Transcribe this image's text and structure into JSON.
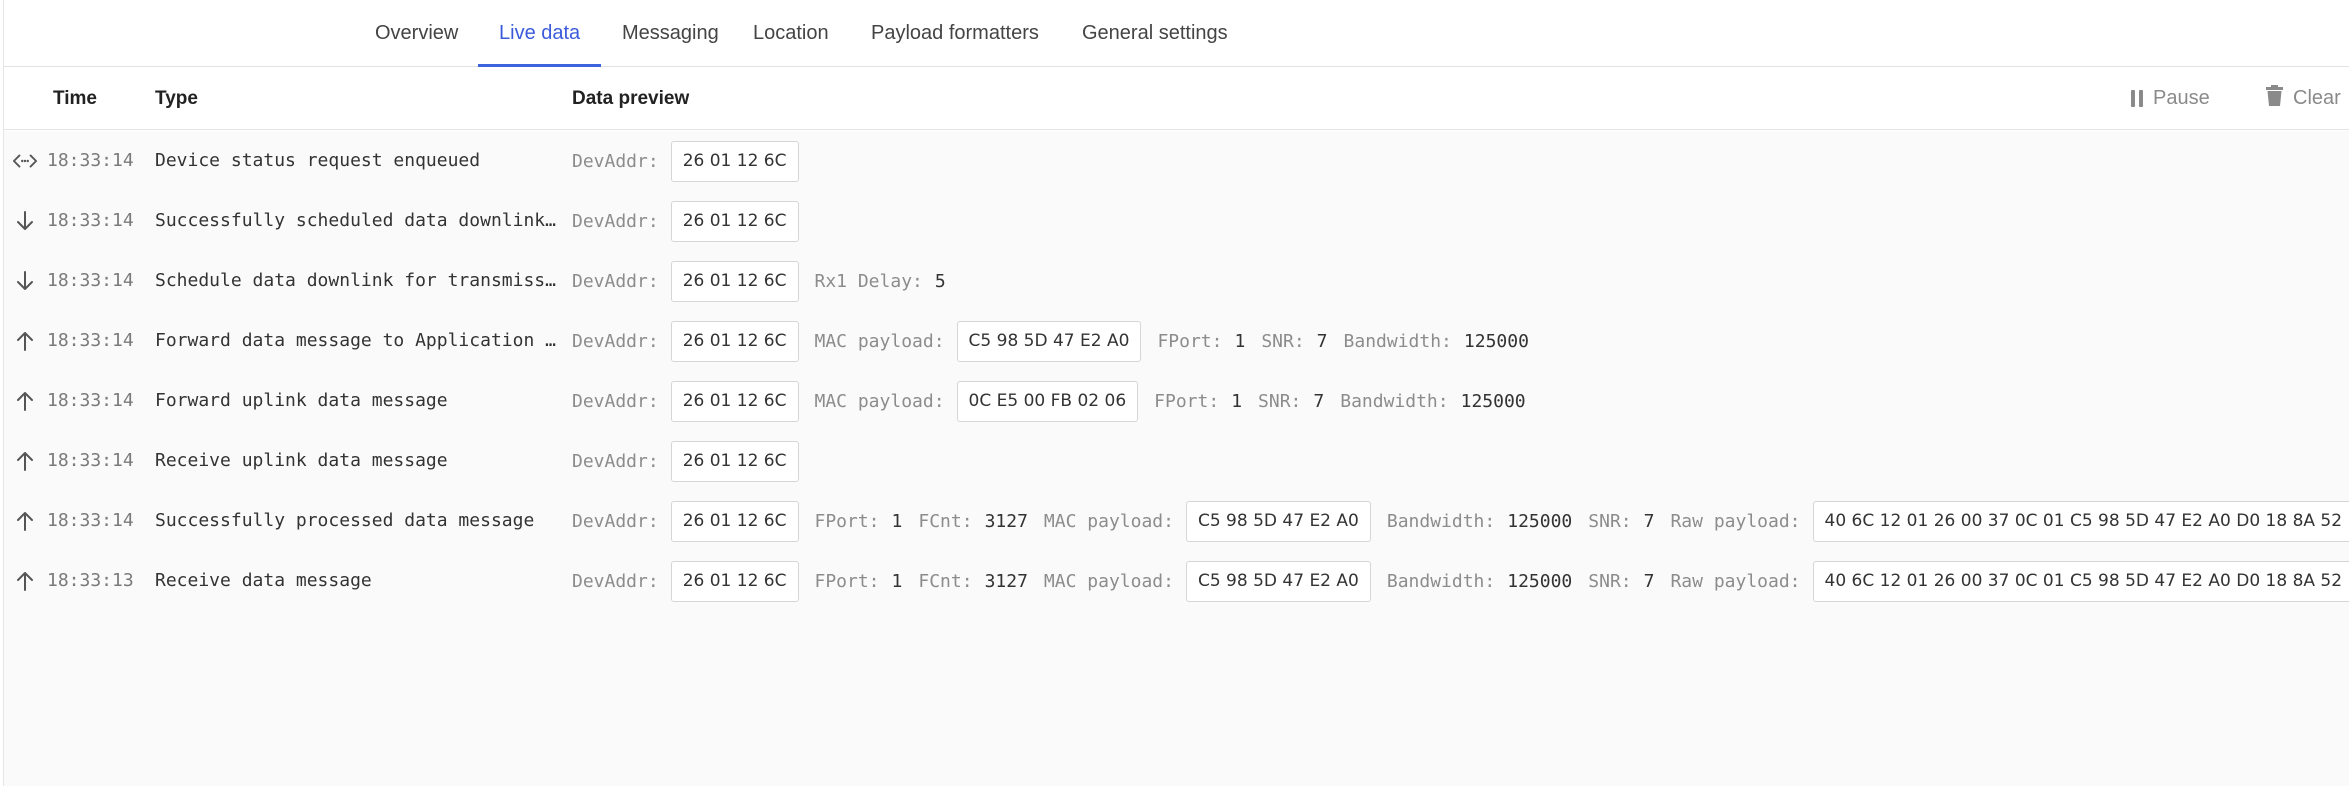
{
  "tabs": [
    {
      "label": "Overview",
      "active": false
    },
    {
      "label": "Live data",
      "active": true
    },
    {
      "label": "Messaging",
      "active": false
    },
    {
      "label": "Location",
      "active": false
    },
    {
      "label": "Payload formatters",
      "active": false
    },
    {
      "label": "General settings",
      "active": false
    }
  ],
  "header": {
    "time": "Time",
    "type": "Type",
    "preview": "Data preview",
    "pause": "Pause",
    "clear": "Clear"
  },
  "colors": {
    "accent": "#3d63dd",
    "label": "#8c8c8c"
  },
  "rows": [
    {
      "icon": "bidirectional-arrow-icon",
      "time": "18:33:14",
      "type": "Device status request enqueued",
      "fields": [
        {
          "label": "DevAddr:",
          "value": "26 01 12 6C",
          "boxed": true
        }
      ]
    },
    {
      "icon": "arrow-down-icon",
      "time": "18:33:14",
      "type": "Successfully scheduled data downlink for transmission",
      "fields": [
        {
          "label": "DevAddr:",
          "value": "26 01 12 6C",
          "boxed": true
        }
      ]
    },
    {
      "icon": "arrow-down-icon",
      "time": "18:33:14",
      "type": "Schedule data downlink for transmission",
      "fields": [
        {
          "label": "DevAddr:",
          "value": "26 01 12 6C",
          "boxed": true
        },
        {
          "label": "Rx1 Delay:",
          "value": "5",
          "boxed": false
        }
      ]
    },
    {
      "icon": "arrow-up-icon",
      "time": "18:33:14",
      "type": "Forward data message to Application Server",
      "fields": [
        {
          "label": "DevAddr:",
          "value": "26 01 12 6C",
          "boxed": true
        },
        {
          "label": "MAC payload:",
          "value": "C5 98 5D 47 E2 A0",
          "boxed": true
        },
        {
          "label": "FPort:",
          "value": "1",
          "boxed": false
        },
        {
          "label": "SNR:",
          "value": "7",
          "boxed": false
        },
        {
          "label": "Bandwidth:",
          "value": "125000",
          "boxed": false
        }
      ]
    },
    {
      "icon": "arrow-up-icon",
      "time": "18:33:14",
      "type": "Forward uplink data message",
      "fields": [
        {
          "label": "DevAddr:",
          "value": "26 01 12 6C",
          "boxed": true
        },
        {
          "label": "MAC payload:",
          "value": "0C E5 00 FB 02 06",
          "boxed": true
        },
        {
          "label": "FPort:",
          "value": "1",
          "boxed": false
        },
        {
          "label": "SNR:",
          "value": "7",
          "boxed": false
        },
        {
          "label": "Bandwidth:",
          "value": "125000",
          "boxed": false
        }
      ]
    },
    {
      "icon": "arrow-up-icon",
      "time": "18:33:14",
      "type": "Receive uplink data message",
      "fields": [
        {
          "label": "DevAddr:",
          "value": "26 01 12 6C",
          "boxed": true
        }
      ]
    },
    {
      "icon": "arrow-up-icon",
      "time": "18:33:14",
      "type": "Successfully processed data message",
      "fields": [
        {
          "label": "DevAddr:",
          "value": "26 01 12 6C",
          "boxed": true
        },
        {
          "label": "FPort:",
          "value": "1",
          "boxed": false
        },
        {
          "label": "FCnt:",
          "value": "3127",
          "boxed": false
        },
        {
          "label": "MAC payload:",
          "value": "C5 98 5D 47 E2 A0",
          "boxed": true
        },
        {
          "label": "Bandwidth:",
          "value": "125000",
          "boxed": false
        },
        {
          "label": "SNR:",
          "value": "7",
          "boxed": false
        },
        {
          "label": "Raw payload:",
          "value": "40 6C 12 01 26 00 37 0C 01 C5 98 5D 47 E2 A0 D0 18 8A 52",
          "boxed": true
        }
      ]
    },
    {
      "icon": "arrow-up-icon",
      "time": "18:33:13",
      "type": "Receive data message",
      "fields": [
        {
          "label": "DevAddr:",
          "value": "26 01 12 6C",
          "boxed": true
        },
        {
          "label": "FPort:",
          "value": "1",
          "boxed": false
        },
        {
          "label": "FCnt:",
          "value": "3127",
          "boxed": false
        },
        {
          "label": "MAC payload:",
          "value": "C5 98 5D 47 E2 A0",
          "boxed": true
        },
        {
          "label": "Bandwidth:",
          "value": "125000",
          "boxed": false
        },
        {
          "label": "SNR:",
          "value": "7",
          "boxed": false
        },
        {
          "label": "Raw payload:",
          "value": "40 6C 12 01 26 00 37 0C 01 C5 98 5D 47 E2 A0 D0 18 8A 52",
          "boxed": true
        }
      ]
    }
  ]
}
